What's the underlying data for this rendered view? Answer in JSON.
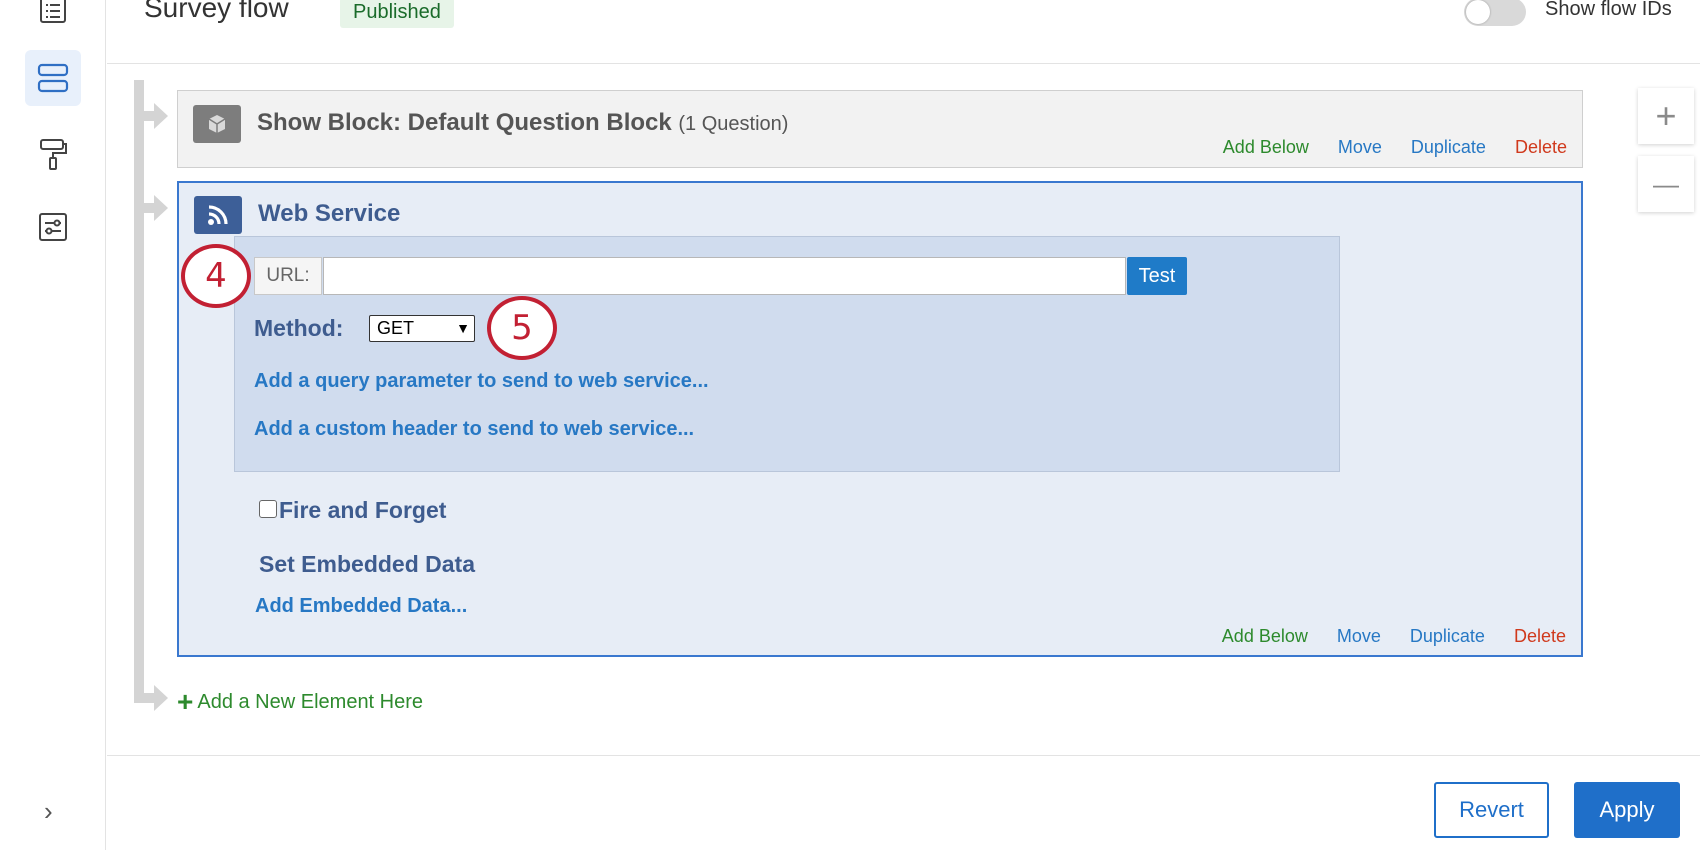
{
  "header": {
    "title": "Survey flow",
    "status": "Published",
    "toggle_label": "Show flow IDs",
    "toggle_on": false
  },
  "rail": {
    "icons": [
      "list-icon",
      "survey-flow-icon",
      "paint-roller-icon",
      "settings-sliders-icon"
    ],
    "expand_icon": "chevron-right-icon"
  },
  "zoom": {
    "in_label": "+",
    "out_label": "—"
  },
  "default_block": {
    "title": "Show Block: Default Question Block",
    "subtitle": "(1 Question)",
    "icon": "cube-icon"
  },
  "web_service": {
    "title": "Web Service",
    "icon": "rss-icon",
    "url_label": "URL:",
    "url_value": "",
    "test_label": "Test",
    "method_label": "Method:",
    "method_value": "GET",
    "add_query_link": "Add a query parameter to send to web service...",
    "add_header_link": "Add a custom header to send to web service...",
    "fire_forget_label": "Fire and Forget",
    "fire_forget_checked": false,
    "embedded_title": "Set Embedded Data",
    "add_embedded_link": "Add Embedded Data..."
  },
  "actions": {
    "add_below": "Add Below",
    "move": "Move",
    "duplicate": "Duplicate",
    "delete": "Delete"
  },
  "callouts": {
    "first": "4",
    "second": "5"
  },
  "add_element": {
    "plus": "+",
    "label": "Add a New Element Here"
  },
  "footer": {
    "revert": "Revert",
    "apply": "Apply"
  },
  "colors": {
    "primary": "#1f6fc9",
    "selected_border": "#3a78cf",
    "add_green": "#2d8a2d",
    "delete_red": "#d0391c",
    "callout_red": "#c22033"
  }
}
